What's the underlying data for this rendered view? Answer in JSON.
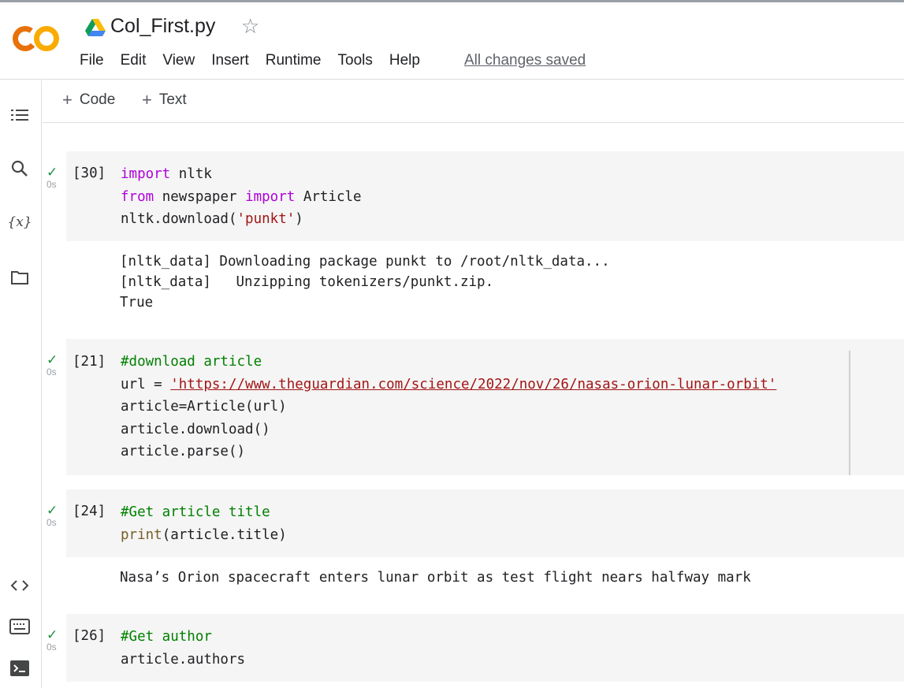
{
  "header": {
    "file_title": "Col_First.py",
    "menu": [
      "File",
      "Edit",
      "View",
      "Insert",
      "Runtime",
      "Tools",
      "Help"
    ],
    "save_status": "All changes saved"
  },
  "toolbar": {
    "add_code_label": "Code",
    "add_text_label": "Text"
  },
  "rail": {
    "icons": [
      "table-of-contents-icon",
      "search-icon",
      "variables-icon",
      "files-icon",
      "code-snippets-icon",
      "command-palette-icon",
      "terminal-icon"
    ],
    "variables_glyph": "{x}"
  },
  "cells": [
    {
      "exec_count": "[30]",
      "duration": "0s",
      "code": {
        "l1_kw": "import",
        "l1_rest": " nltk",
        "l2_kw1": "from",
        "l2_mid": " newspaper ",
        "l2_kw2": "import",
        "l2_rest": " Article",
        "l3_pre": "nltk.download(",
        "l3_str": "'punkt'",
        "l3_post": ")"
      },
      "output": "[nltk_data] Downloading package punkt to /root/nltk_data...\n[nltk_data]   Unzipping tokenizers/punkt.zip.\nTrue"
    },
    {
      "exec_count": "[21]",
      "duration": "0s",
      "code": {
        "l1_comment": "#download article",
        "l2_pre": "url = ",
        "l2_str": "'https://www.theguardian.com/science/2022/nov/26/nasas-orion-lunar-orbit'",
        "l3": "article=Article(url)",
        "l4": "article.download()",
        "l5": "article.parse()"
      }
    },
    {
      "exec_count": "[24]",
      "duration": "0s",
      "code": {
        "l1_comment": "#Get article title",
        "l2_fn": "print",
        "l2_rest": "(article.title)"
      },
      "output": "Nasa’s Orion spacecraft enters lunar orbit as test flight nears halfway mark"
    },
    {
      "exec_count": "[26]",
      "duration": "0s",
      "code": {
        "l1_comment": "#Get author",
        "l2": "article.authors"
      }
    }
  ],
  "colors": {
    "keyword": "#af00db",
    "string": "#a31515",
    "comment": "#008000",
    "function": "#795e26",
    "cell_background": "#f5f5f5",
    "success_check": "#1e8e3e",
    "logo_orange": "#f9ab00",
    "logo_dark_orange": "#e8710a"
  }
}
